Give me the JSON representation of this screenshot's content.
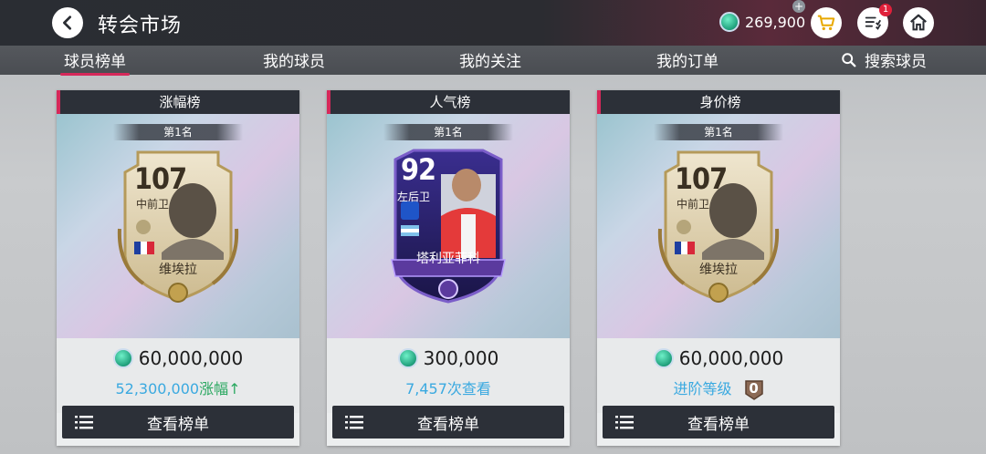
{
  "header": {
    "title": "转会市场",
    "coins": "269,900",
    "notifications_badge": "1",
    "accent_color": "#d6285a"
  },
  "icons": {
    "back": "chevron-left-icon",
    "coin": "coin-icon",
    "add": "plus-icon",
    "cart": "cart-icon",
    "orders": "orders-list-icon",
    "home": "home-icon",
    "search": "search-icon",
    "menu": "menu-list-icon"
  },
  "tabs": [
    {
      "label": "球员榜单",
      "active": true
    },
    {
      "label": "我的球员",
      "active": false
    },
    {
      "label": "我的关注",
      "active": false
    },
    {
      "label": "我的订单",
      "active": false
    },
    {
      "label": "搜索球员",
      "active": false
    }
  ],
  "cards": [
    {
      "title": "涨幅榜",
      "rank": "第1名",
      "player": {
        "rating": "107",
        "position": "中前卫",
        "name": "维埃拉"
      },
      "price": "60,000,000",
      "sub_value": "52,300,000",
      "sub_label": "涨幅",
      "sub_arrow": "↑",
      "button": "查看榜单"
    },
    {
      "title": "人气榜",
      "rank": "第1名",
      "player": {
        "rating": "92",
        "position": "左后卫",
        "name": "塔利亚菲科"
      },
      "price": "300,000",
      "sub_value": "7,457",
      "sub_label": "次查看",
      "button": "查看榜单"
    },
    {
      "title": "身价榜",
      "rank": "第1名",
      "player": {
        "rating": "107",
        "position": "中前卫",
        "name": "维埃拉"
      },
      "price": "60,000,000",
      "sub_label": "进阶等级",
      "upgrade_level": "0",
      "button": "查看榜单"
    }
  ]
}
